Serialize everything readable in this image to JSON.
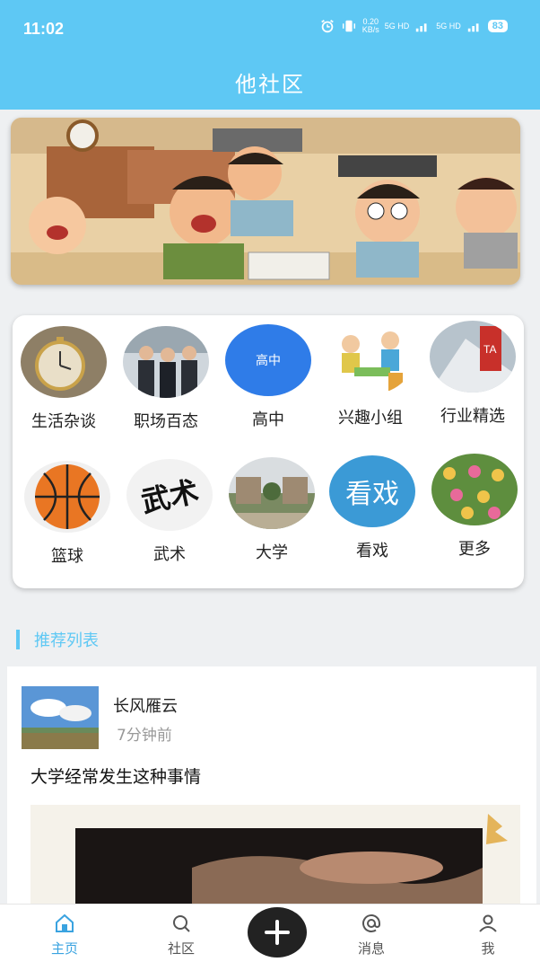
{
  "status_bar": {
    "time": "11:02",
    "net_speed_value": "0.20",
    "net_speed_unit": "KB/s",
    "signal1": "5G HD",
    "signal2": "5G HD",
    "battery": "83"
  },
  "header": {
    "title": "他社区"
  },
  "categories": [
    {
      "label": "生活杂谈",
      "icon": "pocket-watch"
    },
    {
      "label": "职场百态",
      "icon": "office-people"
    },
    {
      "label": "高中",
      "icon": "high-school",
      "badge": "高中"
    },
    {
      "label": "兴趣小组",
      "icon": "chess-cartoon"
    },
    {
      "label": "行业精选",
      "icon": "industry-building"
    },
    {
      "label": "篮球",
      "icon": "basketball"
    },
    {
      "label": "武术",
      "icon": "martial-arts-calligraphy",
      "calligraphy": "武术"
    },
    {
      "label": "大学",
      "icon": "university-campus"
    },
    {
      "label": "看戏",
      "icon": "opera",
      "badge": "看戏"
    },
    {
      "label": "更多",
      "icon": "snails-more"
    }
  ],
  "recommend": {
    "title": "推荐列表"
  },
  "post": {
    "author": "长风雁云",
    "time": "7分钟前",
    "title": "大学经常发生这种事情"
  },
  "bottom_nav": [
    {
      "label": "主页",
      "icon": "home-icon",
      "active": true
    },
    {
      "label": "社区",
      "icon": "search-icon"
    },
    {
      "label": "",
      "icon": "plus-icon"
    },
    {
      "label": "消息",
      "icon": "at-icon"
    },
    {
      "label": "我",
      "icon": "user-icon"
    }
  ],
  "colors": {
    "brand": "#5ec8f4",
    "active_tab": "#3aa3e0",
    "plus_button": "#222222"
  }
}
